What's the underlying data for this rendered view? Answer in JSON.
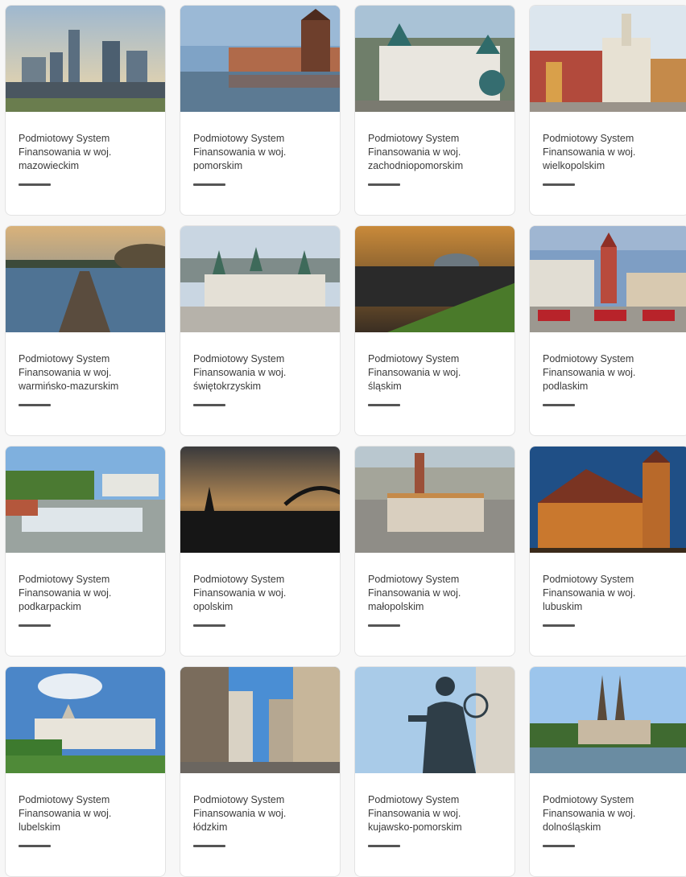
{
  "cards": [
    {
      "line1": "Podmiotowy System",
      "line2": "Finansowania w woj.",
      "region": "mazowieckim",
      "image": "warsaw-skyline-image"
    },
    {
      "line1": "Podmiotowy System",
      "line2": "Finansowania w woj.",
      "region": "pomorskim",
      "image": "gdansk-crane-image"
    },
    {
      "line1": "Podmiotowy System",
      "line2": "Finansowania w woj.",
      "region": "zachodniopomorskim",
      "image": "szczecin-castle-image"
    },
    {
      "line1": "Podmiotowy System",
      "line2": "Finansowania w woj.",
      "region": "wielkopolskim",
      "image": "poznan-old-town-image"
    },
    {
      "line1": "Podmiotowy System",
      "line2": "Finansowania w woj.",
      "region": "warmińsko-mazurskim",
      "image": "lake-pier-image"
    },
    {
      "line1": "Podmiotowy System",
      "line2": "Finansowania w woj.",
      "region": "świętokrzyskim",
      "image": "kielce-cathedral-image"
    },
    {
      "line1": "Podmiotowy System",
      "line2": "Finansowania w woj.",
      "region": "śląskim",
      "image": "spodek-sunset-image"
    },
    {
      "line1": "Podmiotowy System",
      "line2": "Finansowania w woj.",
      "region": "podlaskim",
      "image": "bialystok-square-image"
    },
    {
      "line1": "Podmiotowy System",
      "line2": "Finansowania w woj.",
      "region": "podkarpackim",
      "image": "rzeszow-fountain-image"
    },
    {
      "line1": "Podmiotowy System",
      "line2": "Finansowania w woj.",
      "region": "opolskim",
      "image": "opole-dusk-image"
    },
    {
      "line1": "Podmiotowy System",
      "line2": "Finansowania w woj.",
      "region": "małopolskim",
      "image": "krakow-market-image"
    },
    {
      "line1": "Podmiotowy System",
      "line2": "Finansowania w woj.",
      "region": "lubuskim",
      "image": "gorzow-cathedral-image"
    },
    {
      "line1": "Podmiotowy System",
      "line2": "Finansowania w woj.",
      "region": "lubelskim",
      "image": "lublin-castle-image"
    },
    {
      "line1": "Podmiotowy System",
      "line2": "Finansowania w woj.",
      "region": "łódzkim",
      "image": "lodz-street-image"
    },
    {
      "line1": "Podmiotowy System",
      "line2": "Finansowania w woj.",
      "region": "kujawsko-pomorskim",
      "image": "copernicus-statue-image"
    },
    {
      "line1": "Podmiotowy System",
      "line2": "Finansowania w woj.",
      "region": "dolnośląskim",
      "image": "wroclaw-cathedral-image"
    }
  ]
}
